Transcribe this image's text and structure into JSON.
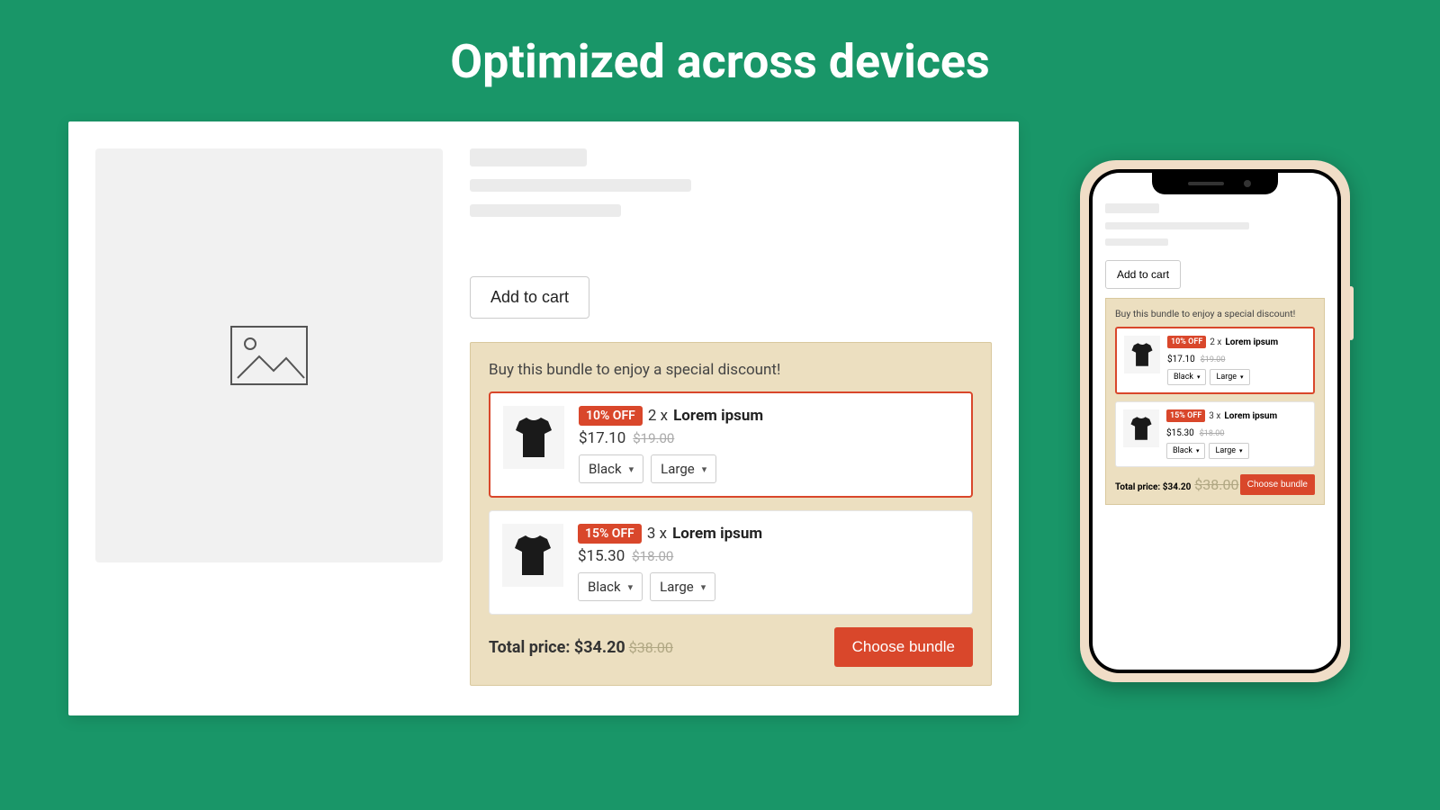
{
  "heading": "Optimized across devices",
  "add_to_cart": "Add to cart",
  "bundle_title": "Buy this bundle to enjoy a special discount!",
  "offers": [
    {
      "badge": "10% OFF",
      "qty": "2 x",
      "name": "Lorem ipsum",
      "price": "$17.10",
      "orig": "$19.00",
      "color": "Black",
      "size": "Large"
    },
    {
      "badge": "15% OFF",
      "qty": "3 x",
      "name": "Lorem ipsum",
      "price": "$15.30",
      "orig": "$18.00",
      "color": "Black",
      "size": "Large"
    }
  ],
  "total_label": "Total price:",
  "total_price": "$34.20",
  "total_orig": "$38.00",
  "choose": "Choose bundle"
}
